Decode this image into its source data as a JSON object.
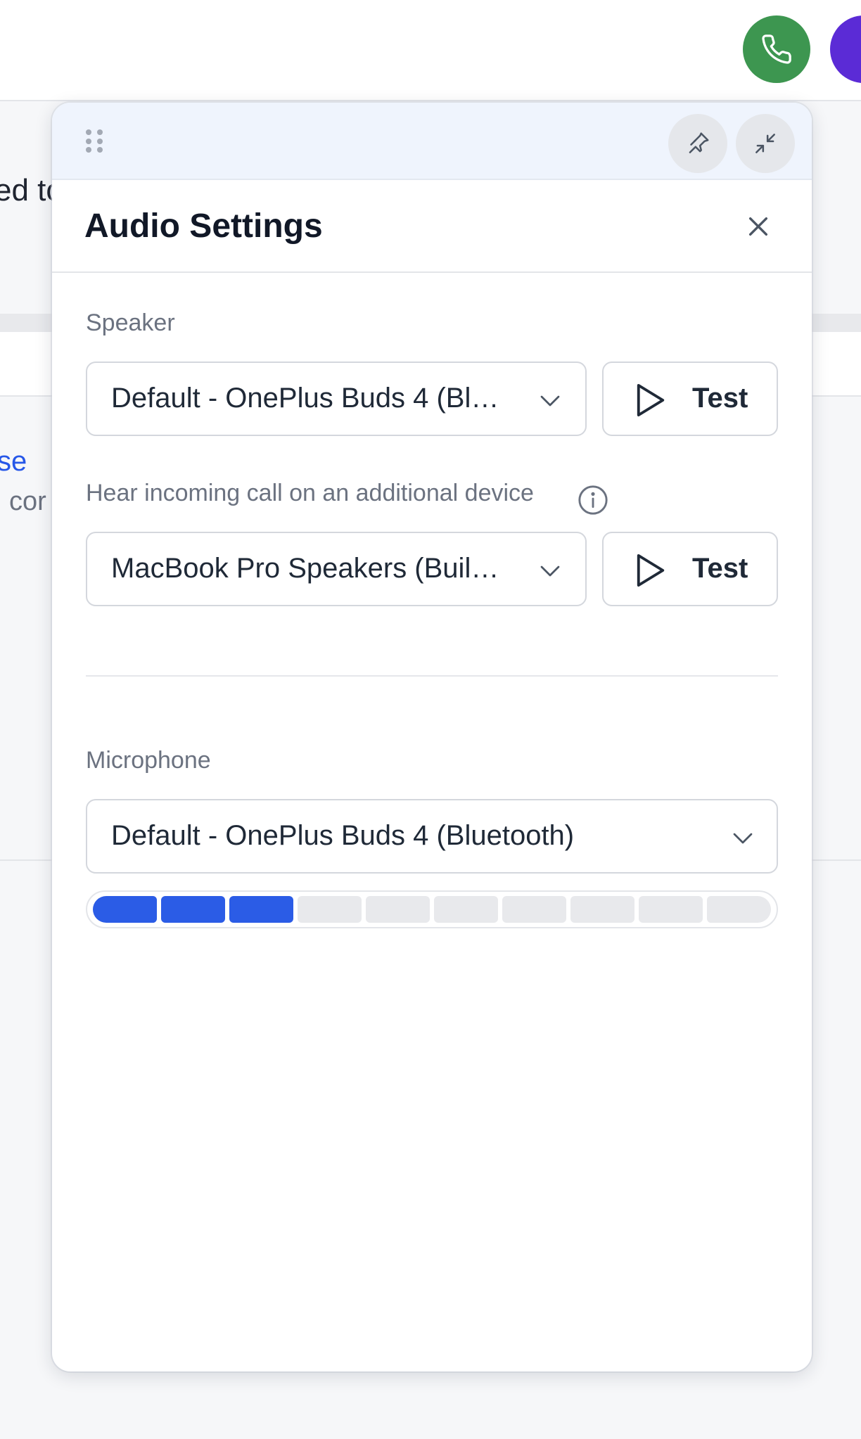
{
  "background": {
    "text_1": "ed to",
    "text_2": "se",
    "text_3": "l cor"
  },
  "header": {
    "call_icon": "phone-icon",
    "pin_icon": "pin-icon",
    "collapse_icon": "minimize-icon"
  },
  "panel": {
    "title": "Audio Settings",
    "close_icon": "close-icon"
  },
  "speaker": {
    "label": "Speaker",
    "selected": "Default - OnePlus Buds 4 (Bl…",
    "test_label": "Test"
  },
  "additional": {
    "label": "Hear incoming call on an additional device",
    "selected": "MacBook Pro Speakers (Buil…",
    "test_label": "Test"
  },
  "microphone": {
    "label": "Microphone",
    "selected": "Default - OnePlus Buds 4 (Bluetooth)",
    "level": 0.3,
    "segments_total": 10,
    "segments_active": 3
  },
  "colors": {
    "accent": "#2b5ce6",
    "call_green": "#3d9650",
    "avatar_purple": "#5b2bd6"
  }
}
